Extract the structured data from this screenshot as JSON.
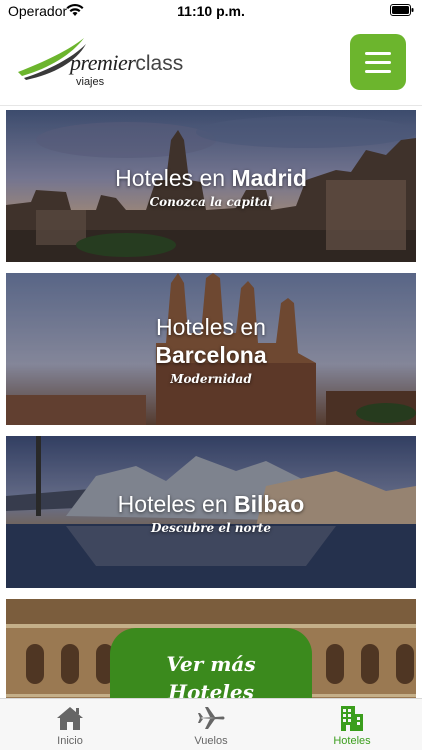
{
  "status_bar": {
    "carrier": "Operador",
    "time": "11:10 p.m."
  },
  "header": {
    "logo": {
      "brand_main": "premier",
      "brand_secondary": "class",
      "tagline": "viajes"
    },
    "menu_icon": "hamburger-icon",
    "accent_color": "#6cb52d"
  },
  "cards": [
    {
      "title_prefix": "Hoteles en",
      "city": "Madrid",
      "subtitle": "Conozca la capital"
    },
    {
      "title_prefix": "Hoteles en",
      "city": "Barcelona",
      "subtitle": "Modernidad"
    },
    {
      "title_prefix": "Hoteles en",
      "city": "Bilbao",
      "subtitle": "Descubre el norte"
    }
  ],
  "more_button": {
    "line1": "Ver más",
    "line2": "Hoteles",
    "color": "#3b8a1d"
  },
  "tabs": [
    {
      "label": "Inicio",
      "icon": "home-icon",
      "active": false
    },
    {
      "label": "Vuelos",
      "icon": "airplane-icon",
      "active": false
    },
    {
      "label": "Hoteles",
      "icon": "building-icon",
      "active": true
    }
  ]
}
